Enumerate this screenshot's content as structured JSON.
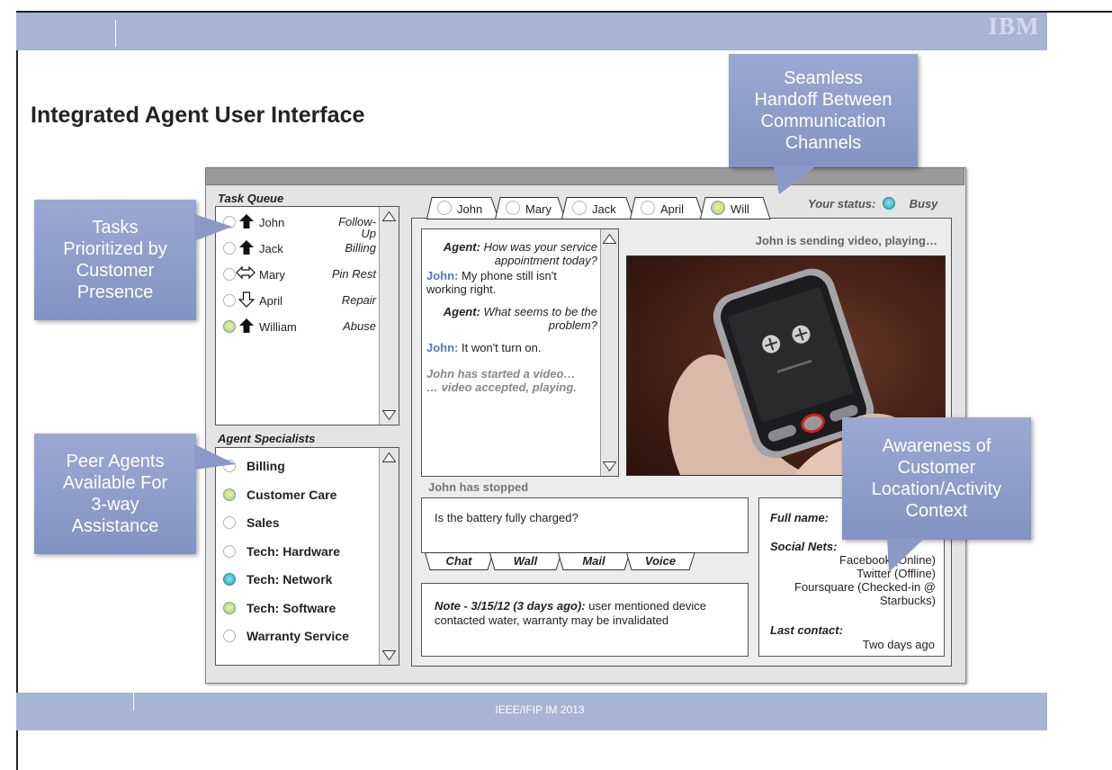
{
  "slide": {
    "title": "Integrated Agent User Interface",
    "logo": "IBM",
    "footer": "IEEE/IFIP IM 2013"
  },
  "callouts": {
    "handoff": "Seamless\nHandoff Between\nCommunication\nChannels",
    "tasks": "Tasks\nPrioritized by\nCustomer\nPresence",
    "peers": "Peer Agents\nAvailable For\n3-way\nAssistance",
    "awareness": "Awareness of\nCustomer\nLocation/Activity\nContext"
  },
  "task_queue": {
    "label": "Task Queue",
    "items": [
      {
        "name": "John",
        "task": "Follow-\nUp",
        "priority_icon": "arrow-up-filled-icon",
        "presence": "offline"
      },
      {
        "name": "Jack",
        "task": "Billing",
        "priority_icon": "arrow-up-filled-icon",
        "presence": "offline"
      },
      {
        "name": "Mary",
        "task": "Pin Rest",
        "priority_icon": "arrow-left-right-icon",
        "presence": "offline"
      },
      {
        "name": "April",
        "task": "Repair",
        "priority_icon": "arrow-down-outline-icon",
        "presence": "offline"
      },
      {
        "name": "William",
        "task": "Abuse",
        "priority_icon": "arrow-up-filled-icon",
        "presence": "online"
      }
    ]
  },
  "agent_specialists": {
    "label": "Agent Specialists",
    "items": [
      {
        "name": "Billing",
        "presence": "offline"
      },
      {
        "name": "Customer Care",
        "presence": "online"
      },
      {
        "name": "Sales",
        "presence": "offline"
      },
      {
        "name": "Tech: Hardware",
        "presence": "offline"
      },
      {
        "name": "Tech: Network",
        "presence": "busy"
      },
      {
        "name": "Tech: Software",
        "presence": "online"
      },
      {
        "name": "Warranty Service",
        "presence": "offline"
      }
    ]
  },
  "customer_tabs": [
    {
      "label": "John",
      "presence": "offline"
    },
    {
      "label": "Mary",
      "presence": "offline"
    },
    {
      "label": "Jack",
      "presence": "offline"
    },
    {
      "label": "April",
      "presence": "offline"
    },
    {
      "label": "Will",
      "presence": "online"
    }
  ],
  "status": {
    "label": "Your status:",
    "value": "Busy"
  },
  "video": {
    "status_text": "John is sending video, playing…",
    "stopped_text": "John has stopped"
  },
  "chat": {
    "messages": [
      {
        "speaker": "Agent:",
        "text": "How was your service appointment today?"
      },
      {
        "speaker": "John:",
        "text": "My phone still isn't working right."
      },
      {
        "speaker": "Agent:",
        "text": "What seems to be the problem?"
      },
      {
        "speaker": "John:",
        "text": "It won't turn on."
      }
    ],
    "system_1": "John has started a video…",
    "system_2": "… video accepted, playing."
  },
  "reply": {
    "text": "Is the battery fully charged?"
  },
  "channel_tabs": [
    "Chat",
    "Wall",
    "Mail",
    "Voice"
  ],
  "note": {
    "label": "Note - 3/15/12 (3 days ago):",
    "text": " user mentioned device contacted water, warranty may be invalidated"
  },
  "customer_info": {
    "full_name_label": "Full name:",
    "social_label": "Social Nets:",
    "social": [
      "Facebook (Online)",
      "Twitter (Offline)",
      "Foursquare (Checked-in @ Starbucks)"
    ],
    "last_contact_label": "Last contact:",
    "last_contact": "Two days ago"
  },
  "colors": {
    "bar": "#a8b4d4",
    "callout": "#8a99c8",
    "online": "#cfe08a",
    "busy": "#3fb3c7"
  }
}
